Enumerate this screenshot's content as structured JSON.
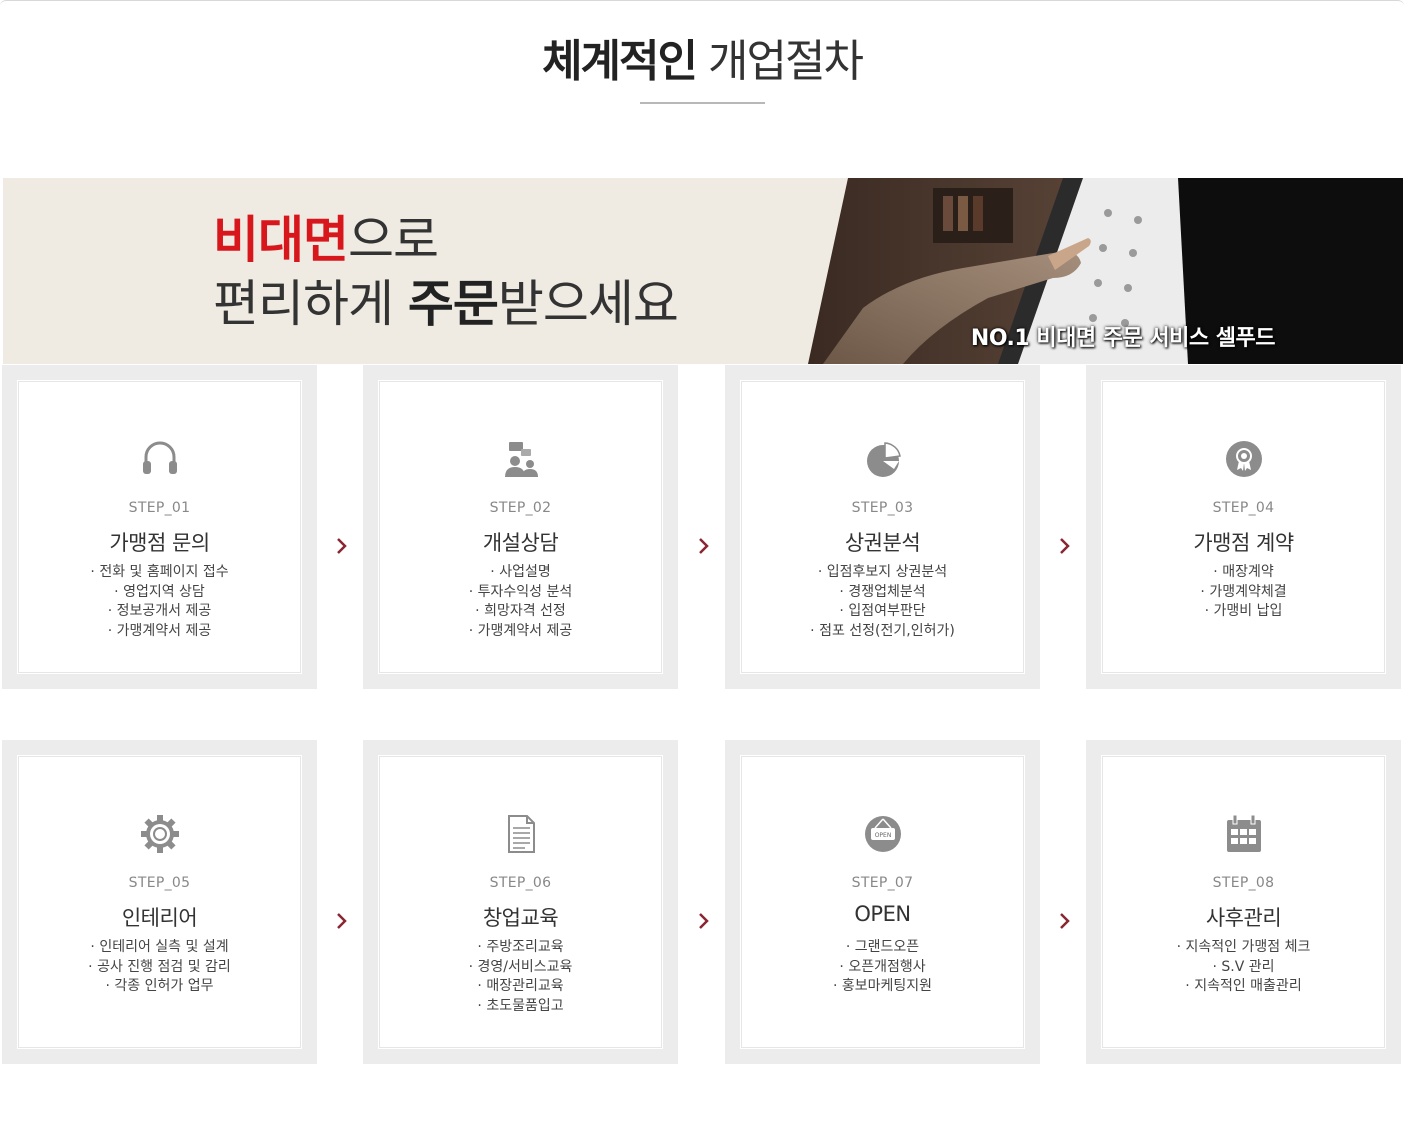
{
  "heading": {
    "bold": "체계적인",
    "light": "개업절차"
  },
  "banner": {
    "line1_red": "비대면",
    "line1_rest": "으로",
    "line2_a": "편리하게 ",
    "line2_b": "주문",
    "line2_c": "받으세요",
    "caption": "NO.1 비대면 주문 서비스  셀푸드"
  },
  "steps": [
    {
      "label": "STEP_01",
      "name": "가맹점 문의",
      "icon": "headphones-icon",
      "items": [
        "전화 및 홈페이지 접수",
        "영업지역 상담",
        "정보공개서 제공",
        "가맹계약서 제공"
      ]
    },
    {
      "label": "STEP_02",
      "name": "개설상담",
      "icon": "consultation-icon",
      "items": [
        "사업설명",
        "투자수익성 분석",
        "희망자격 선정",
        "가맹계약서 제공"
      ]
    },
    {
      "label": "STEP_03",
      "name": "상권분석",
      "icon": "pie-chart-icon",
      "items": [
        "입점후보지 상권분석",
        "경쟁업체분석",
        "입점여부판단",
        "점포 선정(전기,인허가)"
      ]
    },
    {
      "label": "STEP_04",
      "name": "가맹점 계약",
      "icon": "award-icon",
      "items": [
        "매장계약",
        "가맹계약체결",
        "가맹비 납입"
      ]
    },
    {
      "label": "STEP_05",
      "name": "인테리어",
      "icon": "gear-icon",
      "items": [
        "인테리어 실측 및 설계",
        "공사 진행 점검 및 감리",
        "각종 인허가 업무"
      ]
    },
    {
      "label": "STEP_06",
      "name": "창업교육",
      "icon": "document-icon",
      "items": [
        "주방조리교육",
        "경영/서비스교육",
        "매장관리교육",
        "초도물품입고"
      ]
    },
    {
      "label": "STEP_07",
      "name": "OPEN",
      "icon": "open-sign-icon",
      "icon_text": "OPEN",
      "items": [
        "그랜드오픈",
        "오픈개점행사",
        "홍보마케팅지원"
      ]
    },
    {
      "label": "STEP_08",
      "name": "사후관리",
      "icon": "calendar-icon",
      "items": [
        "지속적인 가맹점 체크",
        "S.V 관리",
        "지속적인 매출관리"
      ]
    }
  ],
  "colors": {
    "accent_red": "#d8171c",
    "arrow": "#8a2532",
    "icon_gray": "#8c8c8c"
  }
}
